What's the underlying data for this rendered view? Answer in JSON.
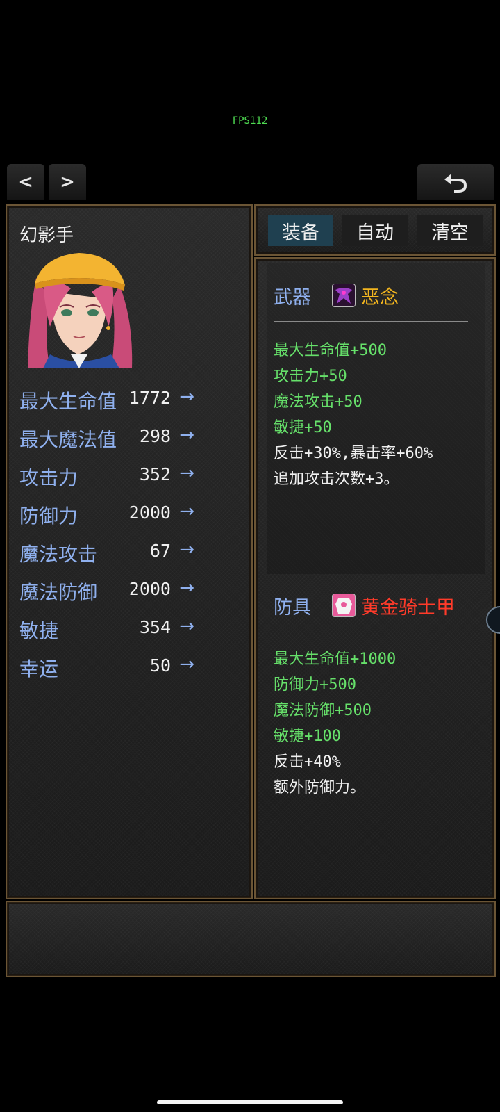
{
  "fps": "FPS112",
  "nav": {
    "prev": "<",
    "next": ">",
    "back_icon": "return-arrow-icon"
  },
  "character": {
    "name": "幻影手"
  },
  "stats": [
    {
      "label": "最大生命值",
      "value": "1772",
      "arrow": "→"
    },
    {
      "label": "最大魔法值",
      "value": "298",
      "arrow": "→"
    },
    {
      "label": "攻击力",
      "value": "352",
      "arrow": "→"
    },
    {
      "label": "防御力",
      "value": "2000",
      "arrow": "→"
    },
    {
      "label": "魔法攻击",
      "value": "67",
      "arrow": "→"
    },
    {
      "label": "魔法防御",
      "value": "2000",
      "arrow": "→"
    },
    {
      "label": "敏捷",
      "value": "354",
      "arrow": "→"
    },
    {
      "label": "幸运",
      "value": "50",
      "arrow": "→"
    }
  ],
  "tabs": [
    {
      "label": "装备",
      "active": true
    },
    {
      "label": "自动",
      "active": false
    },
    {
      "label": "清空",
      "active": false
    }
  ],
  "equipment": {
    "weapon": {
      "slot": "武器",
      "name": "恶念",
      "name_color": "#f2b51f",
      "effects": [
        {
          "text": "最大生命值+500",
          "color": "green"
        },
        {
          "text": "攻击力+50",
          "color": "green"
        },
        {
          "text": "魔法攻击+50",
          "color": "green"
        },
        {
          "text": "敏捷+50",
          "color": "green"
        },
        {
          "text": "反击+30%,暴击率+60%",
          "color": "white"
        },
        {
          "text": "追加攻击次数+3。",
          "color": "white"
        }
      ]
    },
    "armor": {
      "slot": "防具",
      "name": "黄金骑士甲",
      "name_color": "#ff3b2a",
      "effects": [
        {
          "text": "最大生命值+1000",
          "color": "green"
        },
        {
          "text": "防御力+500",
          "color": "green"
        },
        {
          "text": "魔法防御+500",
          "color": "green"
        },
        {
          "text": "敏捷+100",
          "color": "green"
        },
        {
          "text": "反击+40%",
          "color": "white"
        },
        {
          "text": "额外防御力。",
          "color": "white"
        }
      ]
    }
  },
  "colors": {
    "stat_label": "#8fb0ee",
    "bonus_green": "#66e06a",
    "panel_border": "#6b5535"
  }
}
